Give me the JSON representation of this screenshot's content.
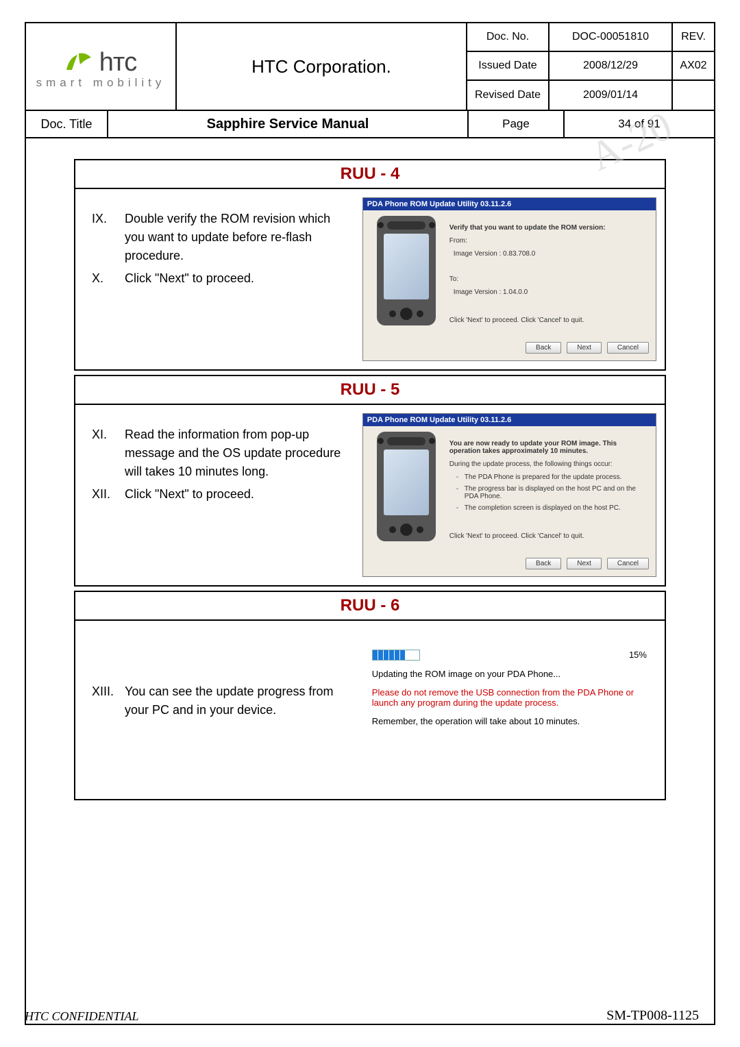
{
  "header": {
    "logo_brand": "hтc",
    "logo_tag": "smart mobility",
    "corp": "HTC Corporation.",
    "docno_lbl": "Doc. No.",
    "docno": "DOC-00051810",
    "rev_lbl": "REV.",
    "rev": "AX02",
    "issued_lbl": "Issued Date",
    "issued": "2008/12/29",
    "revised_lbl": "Revised Date",
    "revised": "2009/01/14",
    "title_lbl": "Doc. Title",
    "title": "Sapphire Service Manual",
    "page_lbl": "Page",
    "page": "34  of  91"
  },
  "ruu4": {
    "title": "RUU - 4",
    "steps": [
      {
        "n": "IX.",
        "t": "Double verify the ROM revision which you want to update before re-flash procedure."
      },
      {
        "n": "X.",
        "t": "Click \"Next\" to proceed."
      }
    ],
    "dlg": {
      "title": "PDA Phone ROM Update Utility 03.11.2.6",
      "head": "Verify that you want to update the ROM version:",
      "from_lbl": "From:",
      "from_val": "Image Version : 0.83.708.0",
      "to_lbl": "To:",
      "to_val": "Image Version : 1.04.0.0",
      "hint": "Click 'Next' to proceed. Click 'Cancel' to quit.",
      "back": "Back",
      "next": "Next",
      "cancel": "Cancel"
    }
  },
  "ruu5": {
    "title": "RUU - 5",
    "steps": [
      {
        "n": "XI.",
        "t": "Read the information from pop-up message and the OS update procedure will takes 10 minutes long."
      },
      {
        "n": "XII.",
        "t": "Click \"Next\" to proceed."
      }
    ],
    "dlg": {
      "title": "PDA Phone ROM Update Utility 03.11.2.6",
      "head": "You are now ready to update your ROM image. This operation takes approximately 10 minutes.",
      "sub": "During the update process, the following things occur:",
      "b1": "The PDA Phone is prepared for the update process.",
      "b2": "The progress bar is displayed on the host PC and on the PDA Phone.",
      "b3": "The completion screen is displayed on the host PC.",
      "hint": "Click 'Next' to proceed. Click 'Cancel' to quit.",
      "back": "Back",
      "next": "Next",
      "cancel": "Cancel"
    }
  },
  "ruu6": {
    "title": "RUU - 6",
    "step": {
      "n": "XIII.",
      "t": "You can see the update progress from your PC and in your device."
    },
    "pct": "15%",
    "l1": "Updating the ROM image on your PDA Phone...",
    "warn": "Please do not remove the USB connection from the PDA Phone or launch any program during the update process.",
    "l2": "Remember, the operation will take about 10 minutes."
  },
  "confidential": "HTC CONFIDENTIAL",
  "doccode": "SM-TP008-1125"
}
